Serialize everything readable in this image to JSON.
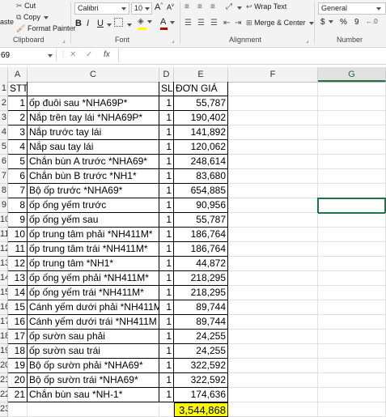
{
  "ribbon": {
    "paste_label": "aste",
    "cut_label": "Cut",
    "copy_label": "Copy",
    "format_painter_label": "Format Painter",
    "clipboard_group": "Clipboard",
    "font_name": "Calibri",
    "font_size": "10",
    "bold": "B",
    "italic": "I",
    "underline": "U",
    "font_color_glyph": "A",
    "font_group": "Font",
    "wrap_text_label": "Wrap Text",
    "merge_center_label": "Merge & Center",
    "alignment_group": "Alignment",
    "number_format": "General",
    "currency": "$",
    "percent": "%",
    "comma": "9",
    "number_group": "Number",
    "fill_color": "#ffff00",
    "font_color": "#c00000"
  },
  "formula_bar": {
    "name_box": "69",
    "cancel_glyph": "✕",
    "enter_glyph": "✓",
    "fx_label": "fx",
    "content": ""
  },
  "columns": [
    "A",
    "C",
    "D",
    "E",
    "F",
    "G"
  ],
  "header_row": {
    "row": "1",
    "stt": "STT",
    "sl": "SL",
    "price": "ĐƠN GIÁ"
  },
  "rows": [
    {
      "row": "2",
      "stt": "1",
      "name": "ốp đuôi sau *NHA69P*",
      "sl": "1",
      "price": "55,787"
    },
    {
      "row": "3",
      "stt": "2",
      "name": "Nắp trên tay lái *NHA69P*",
      "sl": "1",
      "price": "190,402"
    },
    {
      "row": "4",
      "stt": "3",
      "name": "Nắp trước tay lái",
      "sl": "1",
      "price": "141,892"
    },
    {
      "row": "5",
      "stt": "4",
      "name": "Nắp sau tay lái",
      "sl": "1",
      "price": "120,062"
    },
    {
      "row": "6",
      "stt": "5",
      "name": "Chắn bùn A trước *NHA69*",
      "sl": "1",
      "price": "248,614"
    },
    {
      "row": "7",
      "stt": "6",
      "name": "Chắn bùn B trước *NH1*",
      "sl": "1",
      "price": "83,680"
    },
    {
      "row": "8",
      "stt": "7",
      "name": "Bộ ốp trước *NHA69*",
      "sl": "1",
      "price": "654,885"
    },
    {
      "row": "9",
      "stt": "8",
      "name": "ốp ống yếm trước",
      "sl": "1",
      "price": "90,956"
    },
    {
      "row": "10",
      "stt": "9",
      "name": "ốp ống yếm sau",
      "sl": "1",
      "price": "55,787"
    },
    {
      "row": "11",
      "stt": "10",
      "name": "ốp trung tâm phải *NH411M*",
      "sl": "1",
      "price": "186,764"
    },
    {
      "row": "12",
      "stt": "11",
      "name": "ốp trung tâm trái *NH411M*",
      "sl": "1",
      "price": "186,764"
    },
    {
      "row": "13",
      "stt": "12",
      "name": "ốp trung tâm *NH1*",
      "sl": "1",
      "price": "44,872"
    },
    {
      "row": "14",
      "stt": "13",
      "name": "ốp ống yếm phải *NH411M*",
      "sl": "1",
      "price": "218,295"
    },
    {
      "row": "15",
      "stt": "14",
      "name": "ốp ống yếm trái *NH411M*",
      "sl": "1",
      "price": "218,295"
    },
    {
      "row": "16",
      "stt": "15",
      "name": "Cánh yếm dưới phải *NH411M",
      "sl": "1",
      "price": "89,744"
    },
    {
      "row": "17",
      "stt": "16",
      "name": "Cánh yếm dưới trái *NH411M",
      "sl": "1",
      "price": "89,744"
    },
    {
      "row": "18",
      "stt": "17",
      "name": "ốp sườn sau phải",
      "sl": "1",
      "price": "24,255"
    },
    {
      "row": "19",
      "stt": "18",
      "name": "ốp sườn sau trái",
      "sl": "1",
      "price": "24,255"
    },
    {
      "row": "20",
      "stt": "19",
      "name": "Bộ ốp sườn phải *NHA69*",
      "sl": "1",
      "price": "322,592"
    },
    {
      "row": "21",
      "stt": "20",
      "name": "Bộ ốp sườn trái *NHA69*",
      "sl": "1",
      "price": "322,592"
    },
    {
      "row": "22",
      "stt": "21",
      "name": "Chắn bùn sau *NH-1*",
      "sl": "1",
      "price": "174,636"
    }
  ],
  "total_row": {
    "row": "23",
    "total": "3,544,868",
    "highlight_color": "#ffff00"
  },
  "selected_cell": "G9"
}
